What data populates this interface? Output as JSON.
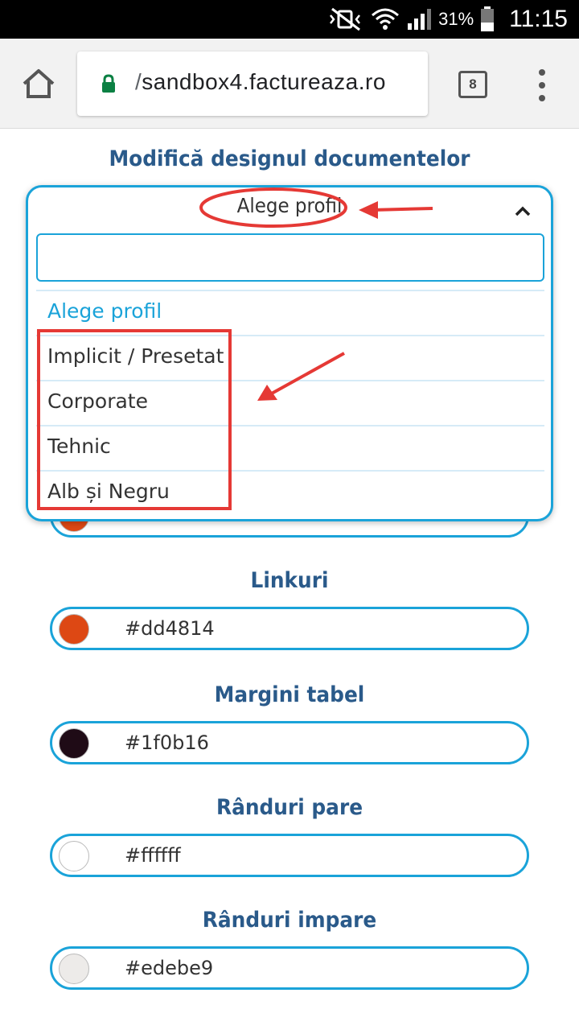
{
  "status_bar": {
    "battery": "31%",
    "time": "11:15"
  },
  "browser": {
    "url_path_prefix": "/",
    "url_domain": "sandbox4.factureaza.ro",
    "tab_count": "8"
  },
  "page": {
    "title": "Modifică designul documentelor",
    "dropdown": {
      "selected": "Alege profil",
      "search_value": "",
      "options": [
        {
          "label": "Alege profil",
          "active": true
        },
        {
          "label": "Implicit / Presetat"
        },
        {
          "label": "Corporate"
        },
        {
          "label": "Tehnic"
        },
        {
          "label": "Alb și Negru"
        }
      ]
    },
    "fields": [
      {
        "label": "Linkuri",
        "value": "#dd4814",
        "swatch": "#dd4814"
      },
      {
        "label": "Margini tabel",
        "value": "#1f0b16",
        "swatch": "#1f0b16"
      },
      {
        "label": "Rânduri pare",
        "value": "#ffffff",
        "swatch": "#ffffff"
      },
      {
        "label": "Rânduri impare",
        "value": "#edebe9",
        "swatch": "#edebe9"
      }
    ],
    "hidden_field_swatch": "#dd4814"
  },
  "colors": {
    "accent": "#1aa3d9",
    "heading": "#2a5a8a",
    "annotation": "#e53935"
  }
}
